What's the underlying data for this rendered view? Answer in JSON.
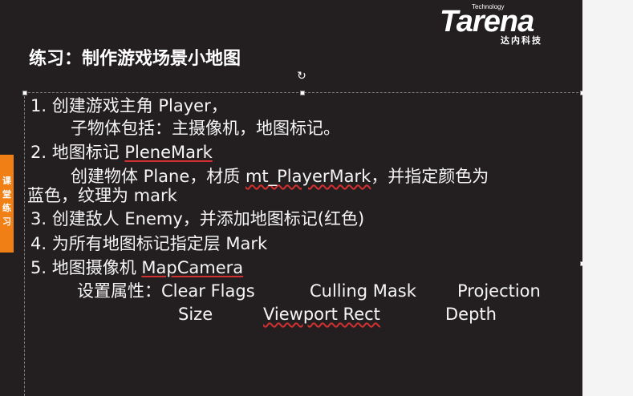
{
  "logo": {
    "tech": "Technology",
    "word": "Tarena",
    "cn": "达内科技"
  },
  "title": "练习：制作游戏场景小地图",
  "side_tab": "课堂练习",
  "lines": [
    "1. 创建游戏主角 Player，",
    "子物体包括：主摄像机，地图标记。",
    "2. 地图标记 ",
    "PleneMark",
    "创建物体 Plane，材质 ",
    "mt_PlayerMark",
    "，并指定颜色为",
    "蓝色，纹理为 mark",
    "3. 创建敌人 Enemy，并添加地图标记(红色)",
    "4. 为所有地图标记指定层 Mark",
    "5. 地图摄像机 ",
    "MapCamera",
    "设置属性：Clear Flags",
    "Culling Mask",
    "Projection",
    "Size",
    "Viewport Rect",
    "Depth"
  ],
  "rotate_icon": "↻",
  "colors": {
    "background": "#231f20",
    "accent_tab": "#f07f16",
    "spellcheck": "#d03030"
  }
}
